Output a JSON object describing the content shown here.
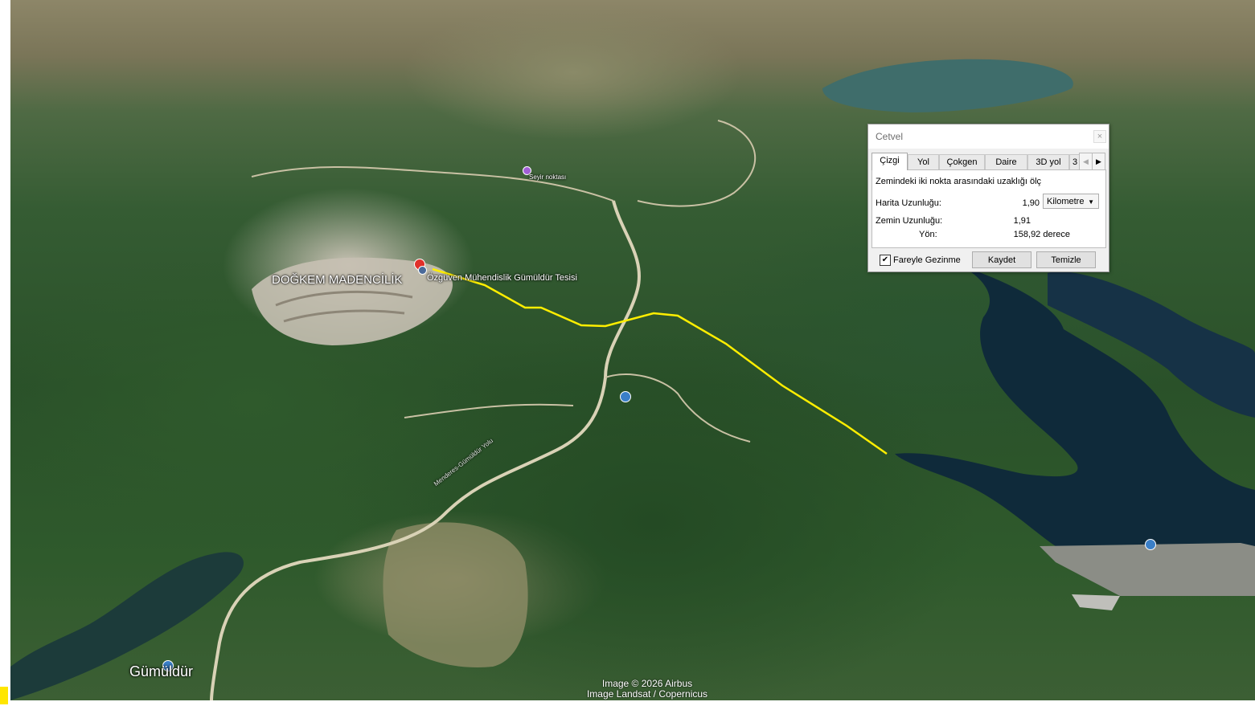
{
  "map": {
    "labels": {
      "mining": "DOĞKEM MADENCİLİK",
      "facility": "Özgüven Mühendislik Gümüldür Tesisi",
      "viewpoint": "Seyir noktası",
      "town": "Gümüldür",
      "road": "Menderes-Gümüldür Yolu"
    },
    "attribution": {
      "line1": "Image © 2026 Airbus",
      "line2": "Image Landsat / Copernicus"
    },
    "colors": {
      "measure_line": "#ffee00",
      "water": "#0f2a3a"
    }
  },
  "ruler": {
    "title": "Cetvel",
    "close_glyph": "×",
    "tabs": [
      {
        "label": "Çizgi",
        "active": true
      },
      {
        "label": "Yol",
        "active": false
      },
      {
        "label": "Çokgen",
        "active": false
      },
      {
        "label": "Daire",
        "active": false
      },
      {
        "label": "3D yol",
        "active": false
      },
      {
        "label": "3",
        "active": false
      }
    ],
    "description": "Zemindeki iki nokta arasındaki uzaklığı ölç",
    "map_length_label": "Harita Uzunluğu:",
    "map_length_value": "1,90",
    "unit": "Kilometre",
    "ground_length_label": "Zemin Uzunluğu:",
    "ground_length_value": "1,91",
    "heading_label": "Yön:",
    "heading_value": "158,92 derece",
    "mouse_nav_label": "Fareyle Gezinme",
    "mouse_nav_checked": true,
    "save_label": "Kaydet",
    "clear_label": "Temizle"
  }
}
